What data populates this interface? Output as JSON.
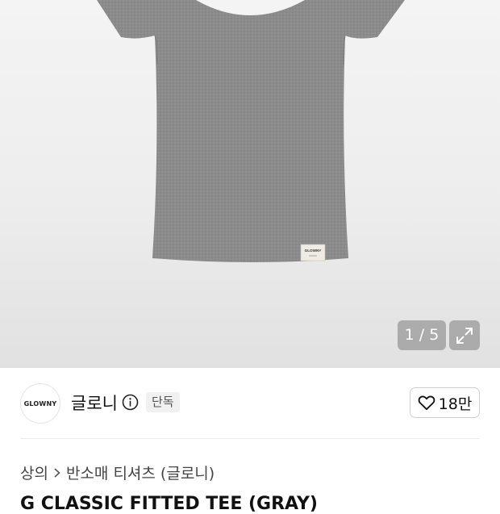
{
  "gallery": {
    "image_alt": "gray fitted short-sleeve t-shirt",
    "label_text": "GLOWNY",
    "counter": "1 / 5",
    "expand_icon": "expand-arrows-icon"
  },
  "brand": {
    "logo_text": "GLOWNY",
    "name": "글로니",
    "info_icon": "info-circle-icon",
    "badge": "단독"
  },
  "like": {
    "icon": "heart-outline-icon",
    "count": "18만"
  },
  "breadcrumb": {
    "items": [
      "상의",
      "반소매 티셔츠 (글로니)"
    ],
    "separator_icon": "chevron-right-icon"
  },
  "product": {
    "title_partial": "G CLASSIC FITTED TEE (GRAY)"
  },
  "colors": {
    "shirt": "#8a8a8a",
    "overlay": "#969696",
    "badge_bg": "#f1f1f1"
  }
}
